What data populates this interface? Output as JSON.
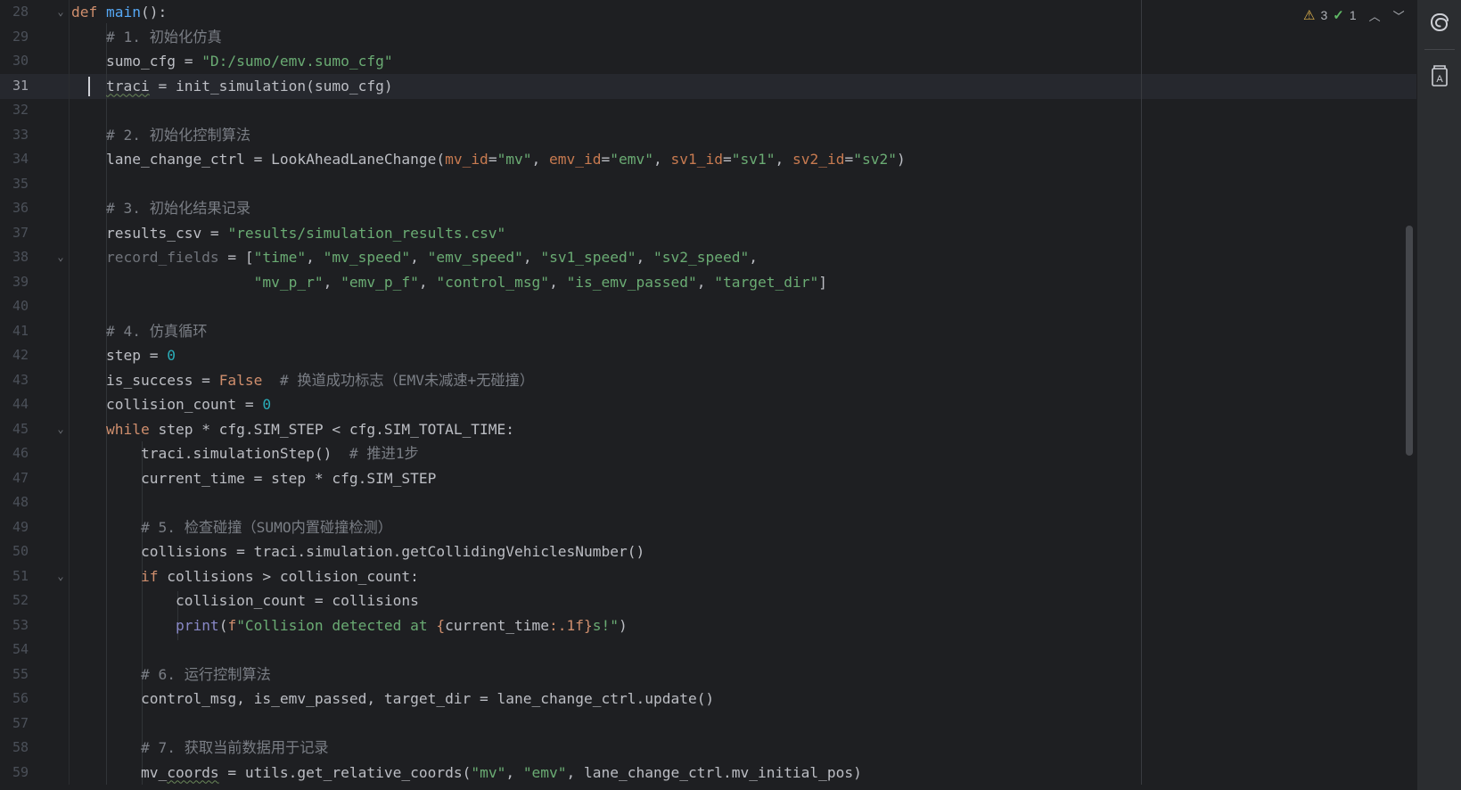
{
  "inspection": {
    "warnings": "3",
    "typos": "1",
    "warning_icon": "warning-triangle-icon",
    "typo_icon": "spellcheck-icon"
  },
  "toolwindow": {
    "top_icon": "ai-assistant-swirl-icon",
    "second_icon": "translate-dictionary-icon",
    "second_glyph": "A"
  },
  "colors": {
    "background": "#1e1f22",
    "keyword": "#cf8e6d",
    "string": "#6aab73",
    "number": "#2aacb8",
    "comment": "#7a7e85",
    "function": "#56a8f5",
    "parameter": "#c77a50"
  },
  "current_line": "31",
  "editor": {
    "lines": [
      {
        "n": "28",
        "fold": "⌄",
        "t": [
          [
            "kw",
            "def "
          ],
          [
            "fn",
            "main"
          ],
          [
            "",
            "():"
          ]
        ]
      },
      {
        "n": "29",
        "t": [
          [
            "",
            "    "
          ],
          [
            "cmt",
            "# 1. 初始化仿真"
          ]
        ]
      },
      {
        "n": "30",
        "t": [
          [
            "",
            "    sumo_cfg = "
          ],
          [
            "str",
            "\"D:/sumo/emv.sumo_cfg\""
          ]
        ]
      },
      {
        "n": "31",
        "t": [
          [
            "",
            "    "
          ],
          [
            "uline",
            "traci"
          ],
          [
            "",
            " = init_simulation(sumo_cfg)"
          ]
        ]
      },
      {
        "n": "32",
        "t": []
      },
      {
        "n": "33",
        "t": [
          [
            "",
            "    "
          ],
          [
            "cmt",
            "# 2. 初始化控制算法"
          ]
        ]
      },
      {
        "n": "34",
        "t": [
          [
            "",
            "    lane_change_ctrl = LookAheadLaneChange("
          ],
          [
            "param",
            "mv_id"
          ],
          [
            "",
            "="
          ],
          [
            "str",
            "\"mv\""
          ],
          [
            "",
            ", "
          ],
          [
            "param",
            "emv_id"
          ],
          [
            "",
            "="
          ],
          [
            "str",
            "\"emv\""
          ],
          [
            "",
            ", "
          ],
          [
            "param",
            "sv1_id"
          ],
          [
            "",
            "="
          ],
          [
            "str",
            "\"sv1\""
          ],
          [
            "",
            ", "
          ],
          [
            "param",
            "sv2_id"
          ],
          [
            "",
            "="
          ],
          [
            "str",
            "\"sv2\""
          ],
          [
            "",
            ")"
          ]
        ]
      },
      {
        "n": "35",
        "t": []
      },
      {
        "n": "36",
        "t": [
          [
            "",
            "    "
          ],
          [
            "cmt",
            "# 3. 初始化结果记录"
          ]
        ]
      },
      {
        "n": "37",
        "t": [
          [
            "",
            "    results_csv = "
          ],
          [
            "str",
            "\"results/simulation_results.csv\""
          ]
        ]
      },
      {
        "n": "38",
        "fold": "⌄",
        "t": [
          [
            "",
            "    "
          ],
          [
            "dim",
            "record_fields"
          ],
          [
            "",
            " = ["
          ],
          [
            "str",
            "\"time\""
          ],
          [
            "",
            ", "
          ],
          [
            "str",
            "\"mv_speed\""
          ],
          [
            "",
            ", "
          ],
          [
            "str",
            "\"emv_speed\""
          ],
          [
            "",
            ", "
          ],
          [
            "str",
            "\"sv1_speed\""
          ],
          [
            "",
            ", "
          ],
          [
            "str",
            "\"sv2_speed\""
          ],
          [
            "",
            ","
          ]
        ]
      },
      {
        "n": "39",
        "t": [
          [
            "",
            "                     "
          ],
          [
            "str",
            "\"mv_p_r\""
          ],
          [
            "",
            ", "
          ],
          [
            "str",
            "\"emv_p_f\""
          ],
          [
            "",
            ", "
          ],
          [
            "str",
            "\"control_msg\""
          ],
          [
            "",
            ", "
          ],
          [
            "str",
            "\"is_emv_passed\""
          ],
          [
            "",
            ", "
          ],
          [
            "str",
            "\"target_dir\""
          ],
          [
            "",
            "]"
          ]
        ]
      },
      {
        "n": "40",
        "t": []
      },
      {
        "n": "41",
        "t": [
          [
            "",
            "    "
          ],
          [
            "cmt",
            "# 4. 仿真循环"
          ]
        ]
      },
      {
        "n": "42",
        "t": [
          [
            "",
            "    step = "
          ],
          [
            "num",
            "0"
          ]
        ]
      },
      {
        "n": "43",
        "t": [
          [
            "",
            "    is_success = "
          ],
          [
            "kw",
            "False"
          ],
          [
            "",
            "  "
          ],
          [
            "cmt",
            "# 换道成功标志（EMV未减速+无碰撞）"
          ]
        ]
      },
      {
        "n": "44",
        "t": [
          [
            "",
            "    collision_count = "
          ],
          [
            "num",
            "0"
          ]
        ]
      },
      {
        "n": "45",
        "fold": "⌄",
        "t": [
          [
            "",
            "    "
          ],
          [
            "kw",
            "while"
          ],
          [
            "",
            " step * cfg.SIM_STEP < cfg.SIM_TOTAL_TIME:"
          ]
        ]
      },
      {
        "n": "46",
        "t": [
          [
            "",
            "        traci.simulationStep()  "
          ],
          [
            "cmt",
            "# 推进1步"
          ]
        ]
      },
      {
        "n": "47",
        "t": [
          [
            "",
            "        current_time = step * cfg.SIM_STEP"
          ]
        ]
      },
      {
        "n": "48",
        "t": []
      },
      {
        "n": "49",
        "t": [
          [
            "",
            "        "
          ],
          [
            "cmt",
            "# 5. 检查碰撞（SUMO内置碰撞检测）"
          ]
        ]
      },
      {
        "n": "50",
        "t": [
          [
            "",
            "        collisions = traci.simulation.getCollidingVehiclesNumber()"
          ]
        ]
      },
      {
        "n": "51",
        "fold": "⌄",
        "t": [
          [
            "",
            "        "
          ],
          [
            "kw",
            "if"
          ],
          [
            "",
            " collisions > collision_count:"
          ]
        ]
      },
      {
        "n": "52",
        "t": [
          [
            "",
            "            collision_count = collisions"
          ]
        ]
      },
      {
        "n": "53",
        "t": [
          [
            "",
            "            "
          ],
          [
            "builtin",
            "print"
          ],
          [
            "",
            "("
          ],
          [
            "fmt",
            "f"
          ],
          [
            "str",
            "\"Collision detected at "
          ],
          [
            "fmt",
            "{"
          ],
          [
            "",
            "current_time"
          ],
          [
            "fmt",
            ":.1f}"
          ],
          [
            "str",
            "s!\""
          ],
          [
            "",
            ")"
          ]
        ]
      },
      {
        "n": "54",
        "t": []
      },
      {
        "n": "55",
        "t": [
          [
            "",
            "        "
          ],
          [
            "cmt",
            "# 6. 运行控制算法"
          ]
        ]
      },
      {
        "n": "56",
        "t": [
          [
            "",
            "        control_msg, is_emv_passed, target_dir = lane_change_ctrl.update()"
          ]
        ]
      },
      {
        "n": "57",
        "t": []
      },
      {
        "n": "58",
        "t": [
          [
            "",
            "        "
          ],
          [
            "cmt",
            "# 7. 获取当前数据用于记录"
          ]
        ]
      },
      {
        "n": "59",
        "t": [
          [
            "",
            "        mv_"
          ],
          [
            "uline",
            "coords"
          ],
          [
            "",
            " = utils.get_relative_coords("
          ],
          [
            "str",
            "\"mv\""
          ],
          [
            "",
            ", "
          ],
          [
            "str",
            "\"emv\""
          ],
          [
            "",
            ", lane_change_ctrl.mv_initial_pos)"
          ]
        ]
      }
    ]
  }
}
